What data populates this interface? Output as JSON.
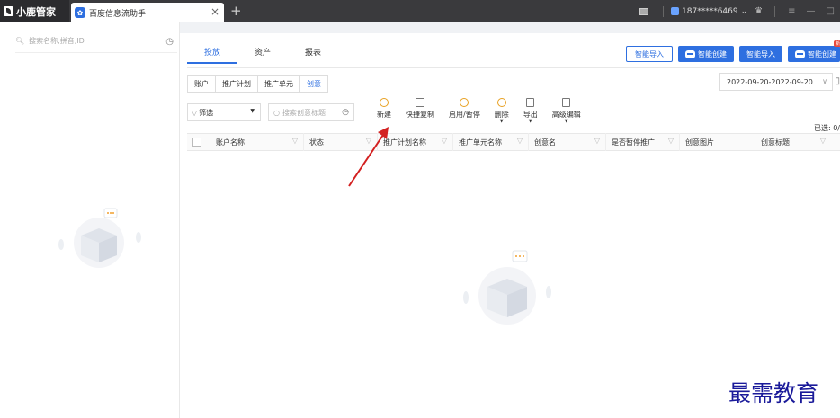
{
  "titlebar": {
    "brand": "小鹿管家",
    "tab_label": "百度信息流助手",
    "tab_close": "×",
    "new_tab": "+",
    "account": "187*****6469",
    "account_caret": "⌄",
    "minimize": "—",
    "maximize": "□",
    "menu": "≡"
  },
  "sidebar": {
    "search_placeholder": "搜索名称,拼音,ID"
  },
  "main": {
    "tabs": [
      {
        "label": "投放"
      },
      {
        "label": "资产"
      },
      {
        "label": "报表"
      }
    ],
    "top_buttons": {
      "import1": "智能导入",
      "create1": "智能创建",
      "import2": "智能导入",
      "create2": "智能创建",
      "new_badge": "新"
    },
    "levels": [
      {
        "label": "账户"
      },
      {
        "label": "推广计划"
      },
      {
        "label": "推广单元"
      },
      {
        "label": "创意"
      }
    ],
    "date_range": "2022-09-20-2022-09-20",
    "filter_label": "筛选",
    "search_placeholder": "搜索创意标题",
    "actions": [
      {
        "label": "新建"
      },
      {
        "label": "快捷复制"
      },
      {
        "label": "启用/暂停"
      },
      {
        "label": "删除"
      },
      {
        "label": "导出"
      },
      {
        "label": "高级编辑"
      }
    ],
    "selected_count": "已选: 0/",
    "columns": [
      {
        "label": "账户名称"
      },
      {
        "label": "状态"
      },
      {
        "label": "推广计划名称"
      },
      {
        "label": "推广单元名称"
      },
      {
        "label": "创意名"
      },
      {
        "label": "是否暂停推广"
      },
      {
        "label": "创意图片"
      },
      {
        "label": "创意标题"
      }
    ]
  },
  "watermark": "最需教育",
  "colors": {
    "accent": "#2e6fe0",
    "titlebar": "#3a3a3d",
    "arrow": "#d32020"
  }
}
